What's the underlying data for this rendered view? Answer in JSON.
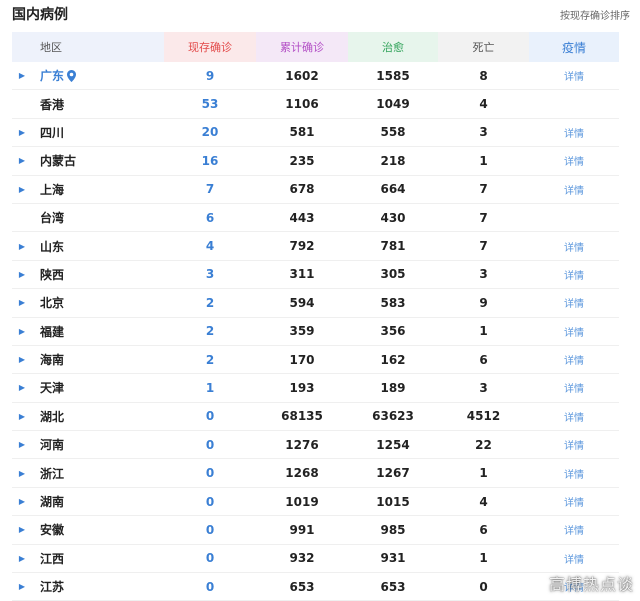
{
  "header": {
    "title": "国内病例",
    "sort_label": "按现存确诊排序"
  },
  "columns": {
    "region": "地区",
    "current": "现存确诊",
    "confirmed": "累计确诊",
    "cured": "治愈",
    "dead": "死亡",
    "detail": "疫情"
  },
  "colors": {
    "current": "#e34a4a",
    "confirmed": "#b34fc6",
    "cured": "#31a35a",
    "detail": "#3a7fd4",
    "current_value": "#3a7fd4"
  },
  "rows": [
    {
      "region": "广东",
      "current": "9",
      "confirmed": "1602",
      "cured": "1585",
      "dead": "8",
      "detail": "详情",
      "expandable": true,
      "located": true
    },
    {
      "region": "香港",
      "current": "53",
      "confirmed": "1106",
      "cured": "1049",
      "dead": "4",
      "detail": "",
      "expandable": false
    },
    {
      "region": "四川",
      "current": "20",
      "confirmed": "581",
      "cured": "558",
      "dead": "3",
      "detail": "详情",
      "expandable": true
    },
    {
      "region": "内蒙古",
      "current": "16",
      "confirmed": "235",
      "cured": "218",
      "dead": "1",
      "detail": "详情",
      "expandable": true
    },
    {
      "region": "上海",
      "current": "7",
      "confirmed": "678",
      "cured": "664",
      "dead": "7",
      "detail": "详情",
      "expandable": true
    },
    {
      "region": "台湾",
      "current": "6",
      "confirmed": "443",
      "cured": "430",
      "dead": "7",
      "detail": "",
      "expandable": false
    },
    {
      "region": "山东",
      "current": "4",
      "confirmed": "792",
      "cured": "781",
      "dead": "7",
      "detail": "详情",
      "expandable": true
    },
    {
      "region": "陕西",
      "current": "3",
      "confirmed": "311",
      "cured": "305",
      "dead": "3",
      "detail": "详情",
      "expandable": true
    },
    {
      "region": "北京",
      "current": "2",
      "confirmed": "594",
      "cured": "583",
      "dead": "9",
      "detail": "详情",
      "expandable": true
    },
    {
      "region": "福建",
      "current": "2",
      "confirmed": "359",
      "cured": "356",
      "dead": "1",
      "detail": "详情",
      "expandable": true
    },
    {
      "region": "海南",
      "current": "2",
      "confirmed": "170",
      "cured": "162",
      "dead": "6",
      "detail": "详情",
      "expandable": true
    },
    {
      "region": "天津",
      "current": "1",
      "confirmed": "193",
      "cured": "189",
      "dead": "3",
      "detail": "详情",
      "expandable": true
    },
    {
      "region": "湖北",
      "current": "0",
      "confirmed": "68135",
      "cured": "63623",
      "dead": "4512",
      "detail": "详情",
      "expandable": true
    },
    {
      "region": "河南",
      "current": "0",
      "confirmed": "1276",
      "cured": "1254",
      "dead": "22",
      "detail": "详情",
      "expandable": true
    },
    {
      "region": "浙江",
      "current": "0",
      "confirmed": "1268",
      "cured": "1267",
      "dead": "1",
      "detail": "详情",
      "expandable": true
    },
    {
      "region": "湖南",
      "current": "0",
      "confirmed": "1019",
      "cured": "1015",
      "dead": "4",
      "detail": "详情",
      "expandable": true
    },
    {
      "region": "安徽",
      "current": "0",
      "confirmed": "991",
      "cured": "985",
      "dead": "6",
      "detail": "详情",
      "expandable": true
    },
    {
      "region": "江西",
      "current": "0",
      "confirmed": "932",
      "cured": "931",
      "dead": "1",
      "detail": "详情",
      "expandable": true
    },
    {
      "region": "江苏",
      "current": "0",
      "confirmed": "653",
      "cured": "653",
      "dead": "0",
      "detail": "详情",
      "expandable": true
    }
  ],
  "watermark": "高博热点谈"
}
